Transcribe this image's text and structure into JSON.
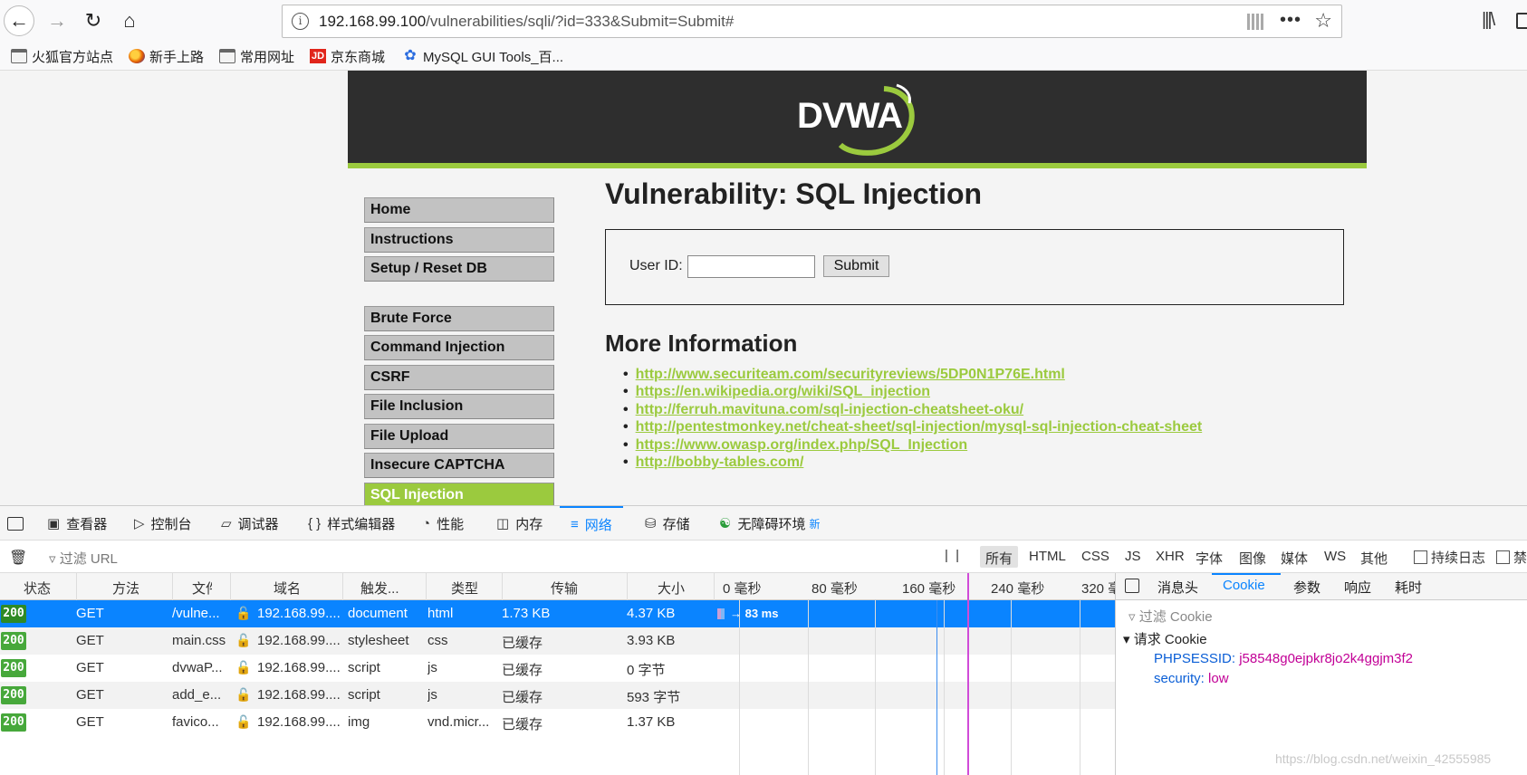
{
  "browser": {
    "url_host": "192.168.99.100",
    "url_path": "/vulnerabilities/sqli/?id=333&Submit=Submit#",
    "bookmarks": [
      {
        "label": "火狐官方站点",
        "icon": "folder-icon"
      },
      {
        "label": "新手上路",
        "icon": "firefox-icon"
      },
      {
        "label": "常用网址",
        "icon": "folder-icon"
      },
      {
        "label": "京东商城",
        "icon": "jd-icon"
      },
      {
        "label": "MySQL GUI Tools_百...",
        "icon": "baidu-paw-icon"
      }
    ],
    "jd_icon_text": "JD"
  },
  "dvwa": {
    "logo_text": "DVWA",
    "menu": [
      {
        "label": "Home"
      },
      {
        "label": "Instructions"
      },
      {
        "label": "Setup / Reset DB"
      },
      {
        "label": "Brute Force"
      },
      {
        "label": "Command Injection"
      },
      {
        "label": "CSRF"
      },
      {
        "label": "File Inclusion"
      },
      {
        "label": "File Upload"
      },
      {
        "label": "Insecure CAPTCHA"
      },
      {
        "label": "SQL Injection",
        "active": true
      }
    ],
    "title": "Vulnerability: SQL Injection",
    "user_id_label": "User ID:",
    "user_id_value": "",
    "submit_label": "Submit",
    "more_info_title": "More Information",
    "links": [
      "http://www.securiteam.com/securityreviews/5DP0N1P76E.html",
      "https://en.wikipedia.org/wiki/SQL_injection",
      "http://ferruh.mavituna.com/sql-injection-cheatsheet-oku/",
      "http://pentestmonkey.net/cheat-sheet/sql-injection/mysql-sql-injection-cheat-sheet",
      "https://www.owasp.org/index.php/SQL_Injection",
      "http://bobby-tables.com/"
    ],
    "accent_color": "#9bca3e"
  },
  "devtools": {
    "tabs": [
      {
        "label": "查看器",
        "icon": "inspector-icon"
      },
      {
        "label": "控制台",
        "icon": "console-icon"
      },
      {
        "label": "调试器",
        "icon": "debugger-icon"
      },
      {
        "label": "样式编辑器",
        "icon": "style-editor-icon"
      },
      {
        "label": "性能",
        "icon": "performance-icon"
      },
      {
        "label": "内存",
        "icon": "memory-icon"
      },
      {
        "label": "网络",
        "icon": "network-icon",
        "selected": true
      },
      {
        "label": "存储",
        "icon": "storage-icon"
      },
      {
        "label": "无障碍环境",
        "icon": "accessibility-icon",
        "badge": "新"
      }
    ],
    "filter_placeholder": "过滤 URL",
    "type_filters": [
      "所有",
      "HTML",
      "CSS",
      "JS",
      "XHR",
      "字体",
      "图像",
      "媒体",
      "WS",
      "其他"
    ],
    "persist_log": "持续日志",
    "disable_cache": "禁",
    "columns": [
      "状态",
      "方法",
      "文件",
      "域名",
      "触发...",
      "类型",
      "传输",
      "大小"
    ],
    "timeline_ticks": [
      "0 毫秒",
      "80 毫秒",
      "160 毫秒",
      "240 毫秒",
      "320 毫"
    ],
    "requests": [
      {
        "status": "200",
        "method": "GET",
        "file": "/vulne...",
        "domain": "192.168.99....",
        "cause": "document",
        "type": "html",
        "transferred": "1.73 KB",
        "size": "4.37 KB",
        "timing": "→ 83 ms",
        "selected": true
      },
      {
        "status": "200",
        "method": "GET",
        "file": "main.css",
        "domain": "192.168.99....",
        "cause": "stylesheet",
        "type": "css",
        "transferred": "已缓存",
        "size": "3.93 KB"
      },
      {
        "status": "200",
        "method": "GET",
        "file": "dvwaP...",
        "domain": "192.168.99....",
        "cause": "script",
        "type": "js",
        "transferred": "已缓存",
        "size": "0 字节"
      },
      {
        "status": "200",
        "method": "GET",
        "file": "add_e...",
        "domain": "192.168.99....",
        "cause": "script",
        "type": "js",
        "transferred": "已缓存",
        "size": "593 字节"
      },
      {
        "status": "200",
        "method": "GET",
        "file": "favico...",
        "domain": "192.168.99....",
        "cause": "img",
        "type": "vnd.micr...",
        "transferred": "已缓存",
        "size": "1.37 KB"
      }
    ],
    "side_tabs": [
      "消息头",
      "Cookie",
      "参数",
      "响应",
      "耗时"
    ],
    "cookie_filter": "过滤 Cookie",
    "request_cookie_title": "请求 Cookie",
    "cookies": [
      {
        "key": "PHPSESSID:",
        "value": "j58548g0ejpkr8jo2k4ggjm3f2"
      },
      {
        "key": "security:",
        "value": "low"
      }
    ]
  },
  "watermark": "https://blog.csdn.net/weixin_42555985"
}
